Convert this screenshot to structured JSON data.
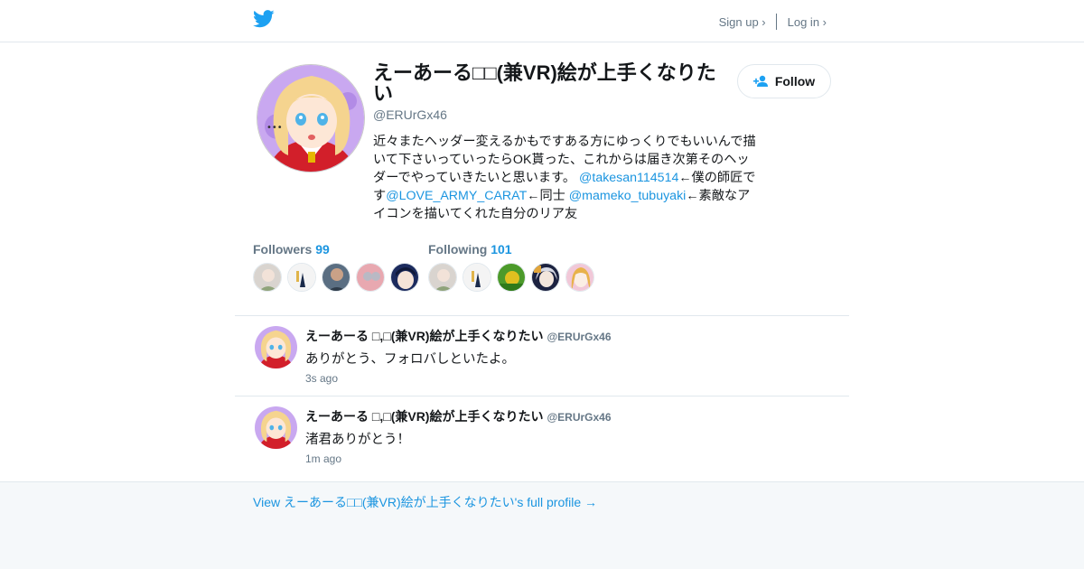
{
  "header": {
    "logo_icon": "twitter-bird-icon",
    "sign_up": "Sign up ›",
    "log_in": "Log in ›",
    "brand_color": "#1da1f2"
  },
  "profile": {
    "name": "えーあーる□□(兼VR)絵が上手くなりたい",
    "handle": "@ERUrGx46",
    "follow_label": "Follow",
    "bio": {
      "part1": "近々またヘッダー変えるかもですある方にゆっくりでもいいんで描いて下さいっていったらOK貰った、これからは届き次第そのヘッダーでやっていきたいと思います。 ",
      "mention1": "@takesan114514",
      "part2": "←僕の師匠です",
      "mention2": "@LOVE_ARMY_CARAT",
      "part3": "←同士 ",
      "mention3": "@mameko_tubuyaki",
      "part4": "←素敵なアイコンを描いてくれた自分のリア友"
    }
  },
  "followers": {
    "label": "Followers",
    "count": "99"
  },
  "following": {
    "label": "Following",
    "count": "101"
  },
  "tweets": [
    {
      "name": "えーあーる □,□(兼VR)絵が上手くなりたい",
      "handle": "@ERUrGx46",
      "text": "ありがとう、フォロバしといたよ。",
      "time": "3s ago"
    },
    {
      "name": "えーあーる □,□(兼VR)絵が上手くなりたい",
      "handle": "@ERUrGx46",
      "text": "渚君ありがとう！",
      "time": "1m ago"
    }
  ],
  "footer": {
    "full_profile_link": "View えーあーる□□(兼VR)絵が上手くなりたい's full profile →"
  }
}
